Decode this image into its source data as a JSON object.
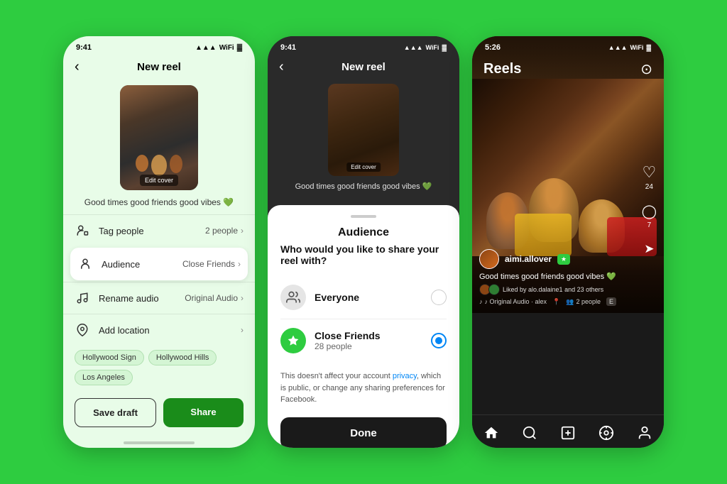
{
  "bg_color": "#2ecc40",
  "phone1": {
    "status_time": "9:41",
    "nav_title": "New reel",
    "edit_cover": "Edit cover",
    "caption": "Good times good friends good vibes 💚",
    "menu_items": [
      {
        "id": "tag_people",
        "label": "Tag people",
        "value": "2 people",
        "icon": "person-tag"
      },
      {
        "id": "audience",
        "label": "Audience",
        "value": "Close Friends",
        "icon": "audience",
        "highlighted": true
      },
      {
        "id": "rename_audio",
        "label": "Rename audio",
        "value": "Original Audio",
        "icon": "music"
      },
      {
        "id": "add_location",
        "label": "Add location",
        "value": "",
        "icon": "location"
      }
    ],
    "location_tags": [
      "Hollywood Sign",
      "Hollywood Hills",
      "Los Angeles"
    ],
    "btn_save": "Save draft",
    "btn_share": "Share"
  },
  "phone2": {
    "status_time": "9:41",
    "nav_title": "New reel",
    "edit_cover": "Edit cover",
    "caption": "Good times good friends good vibes 💚",
    "sheet": {
      "handle": true,
      "title": "Audience",
      "question": "Who would you like to share your reel with?",
      "options": [
        {
          "id": "everyone",
          "label": "Everyone",
          "count": "",
          "selected": false,
          "icon": "people-group"
        },
        {
          "id": "close_friends",
          "label": "Close Friends",
          "count": "28 people",
          "selected": true,
          "icon": "star-green"
        }
      ],
      "privacy_text": "This doesn't affect your account ",
      "privacy_link": "privacy",
      "privacy_text2": ", which is public, or change any sharing preferences for Facebook.",
      "done_btn": "Done"
    }
  },
  "phone3": {
    "status_time": "5:26",
    "header_title": "Reels",
    "reel": {
      "username": "aimi.allover",
      "close_friends_badge": "★",
      "caption": "Good times good friends good vibes 💚",
      "liked_by": "Liked by alo.dalaine1 and 23 others",
      "audio": "♪ Original Audio · alex",
      "people_count": "2 people",
      "location_icon": "📍",
      "location_badge": "E",
      "side_actions": [
        {
          "id": "like",
          "icon": "♡",
          "count": "24"
        },
        {
          "id": "comment",
          "icon": "💬",
          "count": "7"
        },
        {
          "id": "share",
          "icon": "✈",
          "count": ""
        }
      ]
    },
    "bottom_nav": [
      {
        "id": "home",
        "icon": "⌂"
      },
      {
        "id": "search",
        "icon": "⊕"
      },
      {
        "id": "create",
        "icon": "⊕"
      },
      {
        "id": "reels",
        "icon": "▶"
      },
      {
        "id": "profile",
        "icon": "○"
      }
    ]
  }
}
